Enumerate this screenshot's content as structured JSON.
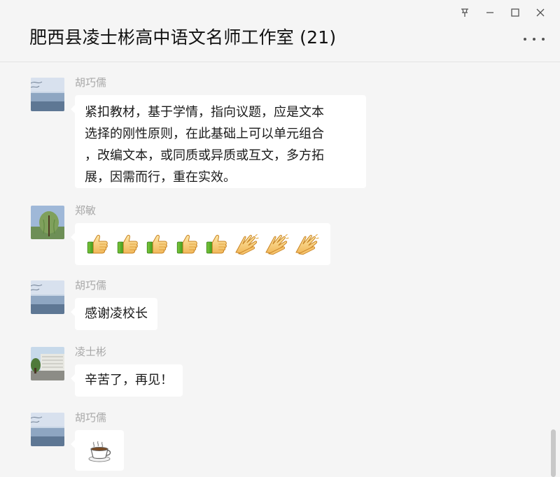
{
  "window": {
    "title": "肥西县凌士彬高中语文名师工作室 (21)",
    "controls": [
      "pin-icon",
      "minimize-icon",
      "maximize-icon",
      "close-icon"
    ]
  },
  "messages": [
    {
      "sender": "胡巧儒",
      "avatar": "lake-scenery-avatar",
      "type": "text",
      "lines": [
        "紧扣教材，基于学情，指向议题，应是文本",
        "选择的刚性原则，在此基础上可以单元组合",
        "，改编文本，或同质或异质或互文，多方拓",
        "展，因需而行，重在实效。"
      ]
    },
    {
      "sender": "郑敏",
      "avatar": "willow-tree-avatar",
      "type": "emoji",
      "emojis": [
        "thumbs-up",
        "thumbs-up",
        "thumbs-up",
        "thumbs-up",
        "thumbs-up",
        "clap",
        "clap",
        "clap"
      ]
    },
    {
      "sender": "胡巧儒",
      "avatar": "lake-scenery-avatar",
      "type": "text",
      "lines": [
        "感谢凌校长"
      ]
    },
    {
      "sender": "凌士彬",
      "avatar": "campus-building-avatar",
      "type": "text",
      "lines": [
        "辛苦了，再见！"
      ]
    },
    {
      "sender": "胡巧儒",
      "avatar": "lake-scenery-avatar",
      "type": "emoji",
      "emojis": [
        "coffee"
      ]
    }
  ],
  "colors": {
    "background": "#f5f5f5",
    "bubble": "#ffffff",
    "sender_name": "#a8a8a8",
    "scrollbar": "#c8c8c8"
  }
}
